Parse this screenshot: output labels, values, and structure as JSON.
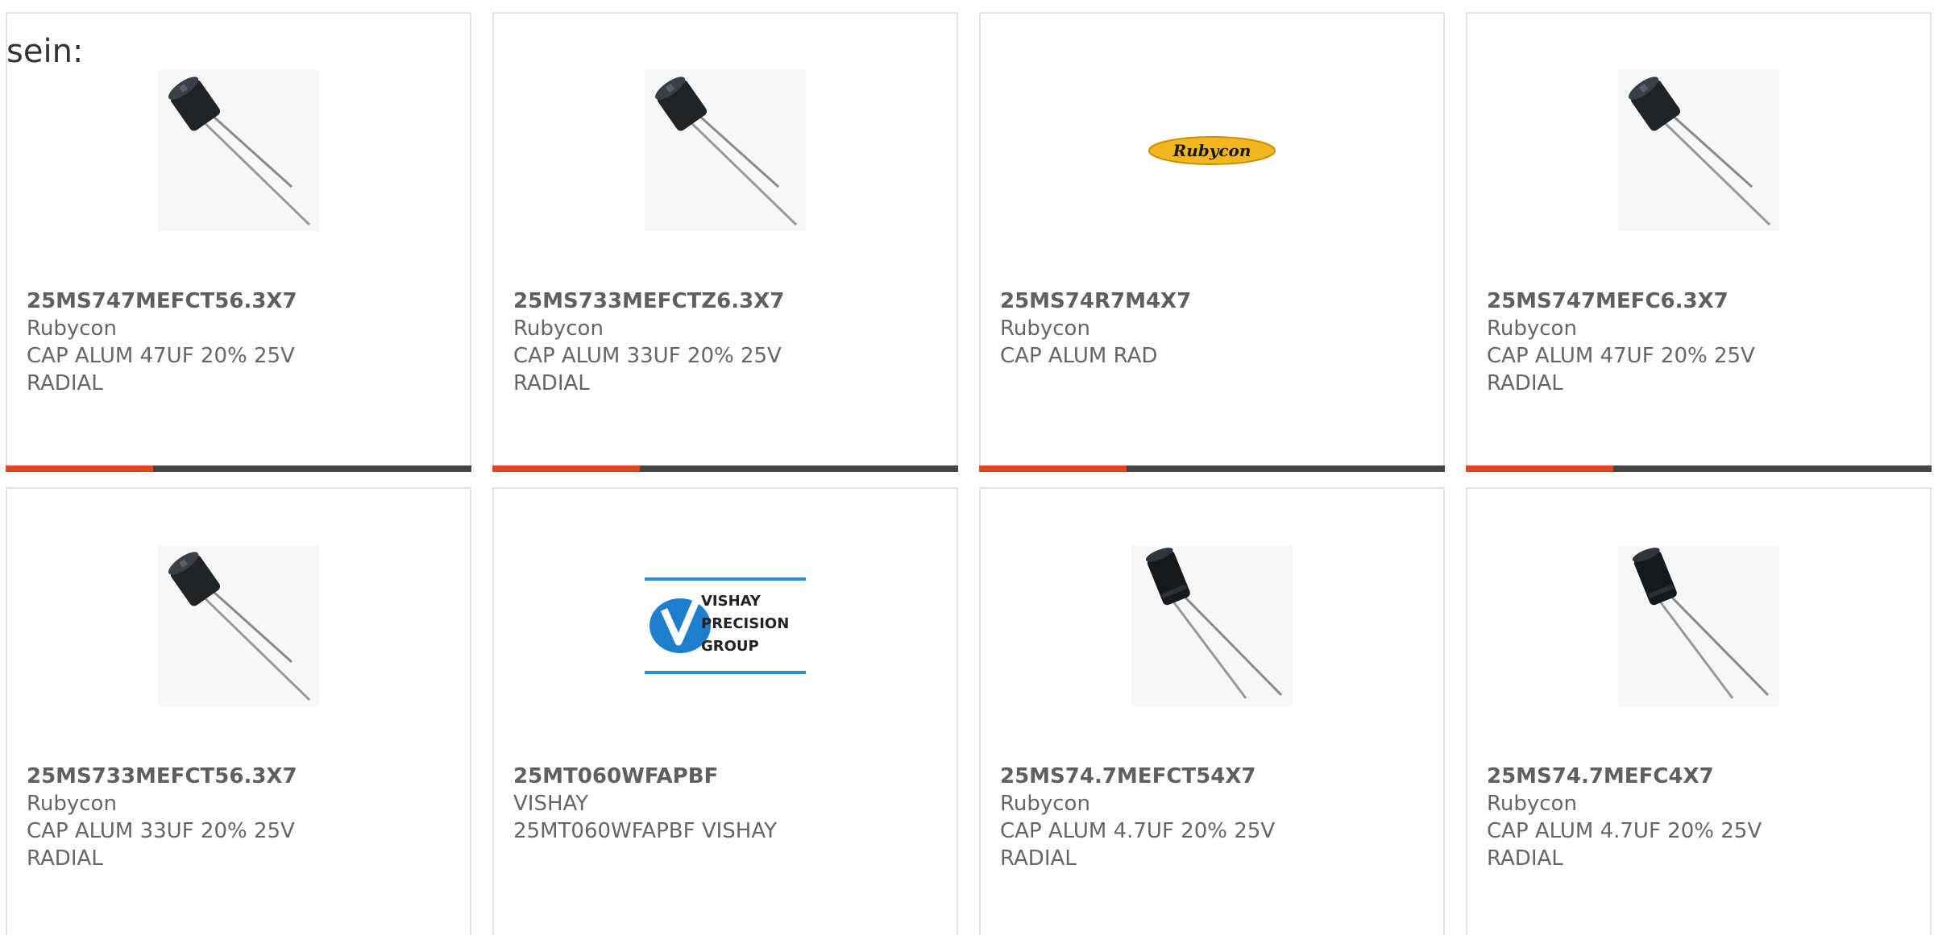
{
  "intro_text": "sein:",
  "colors": {
    "accent": "#e8411e",
    "bar": "#444444",
    "border": "#e4e4e4",
    "text": "#666666"
  },
  "products": [
    {
      "part_number": "25MS747MEFCT56.3X7",
      "manufacturer": "Rubycon",
      "description": "CAP ALUM 47UF 20% 25V RADIAL",
      "image": "capacitor-icon"
    },
    {
      "part_number": "25MS733MEFCTZ6.3X7",
      "manufacturer": "Rubycon",
      "description": "CAP ALUM 33UF 20% 25V RADIAL",
      "image": "capacitor-icon"
    },
    {
      "part_number": "25MS74R7M4X7",
      "manufacturer": "Rubycon",
      "description": "CAP ALUM RAD",
      "image": "rubycon-logo",
      "logo_text": "Rubycon"
    },
    {
      "part_number": "25MS747MEFC6.3X7",
      "manufacturer": "Rubycon",
      "description": "CAP ALUM 47UF 20% 25V RADIAL",
      "image": "capacitor-icon"
    },
    {
      "part_number": "25MS733MEFCT56.3X7",
      "manufacturer": "Rubycon",
      "description": "CAP ALUM 33UF 20% 25V RADIAL",
      "image": "capacitor-icon"
    },
    {
      "part_number": "25MT060WFAPBF",
      "manufacturer": "VISHAY",
      "description": "25MT060WFAPBF VISHAY",
      "image": "vishay-logo",
      "logo_lines": [
        "VISHAY",
        "PRECISION",
        "GROUP"
      ]
    },
    {
      "part_number": "25MS74.7MEFCT54X7",
      "manufacturer": "Rubycon",
      "description": "CAP ALUM 4.7UF 20% 25V RADIAL",
      "image": "capacitor-tall-icon"
    },
    {
      "part_number": "25MS74.7MEFC4X7",
      "manufacturer": "Rubycon",
      "description": "CAP ALUM 4.7UF 20% 25V RADIAL",
      "image": "capacitor-tall-icon"
    }
  ]
}
